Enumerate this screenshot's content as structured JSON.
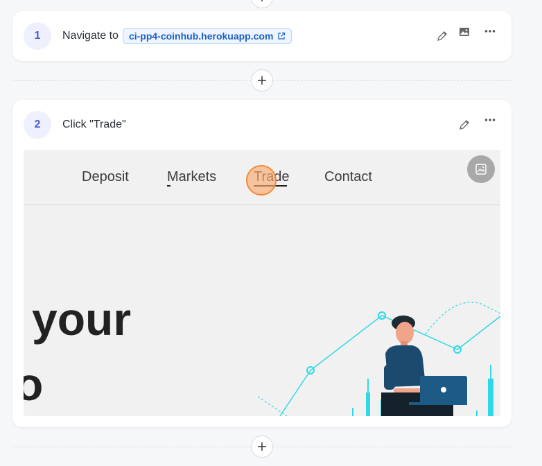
{
  "step1": {
    "number": "1",
    "text": "Navigate to",
    "link": "ci-pp4-coinhub.herokuapp.com",
    "icons": [
      "pencil-icon",
      "image-icon",
      "more-dots-icon"
    ]
  },
  "step2": {
    "number": "2",
    "text": "Click \"Trade\"",
    "icons": [
      "pencil-icon",
      "more-dots-icon"
    ],
    "screenshot": {
      "nav": [
        "Deposit",
        "Markets",
        "Trade",
        "Contact"
      ],
      "hero_line1": "your",
      "hero_line2": "o",
      "accent": "#2fd8e6",
      "person_shirt": "#1c4a6e"
    }
  },
  "colors": {
    "step_accent": "#4d5bd4",
    "link": "#1f5fbf",
    "click_marker": "#f08a3a"
  }
}
